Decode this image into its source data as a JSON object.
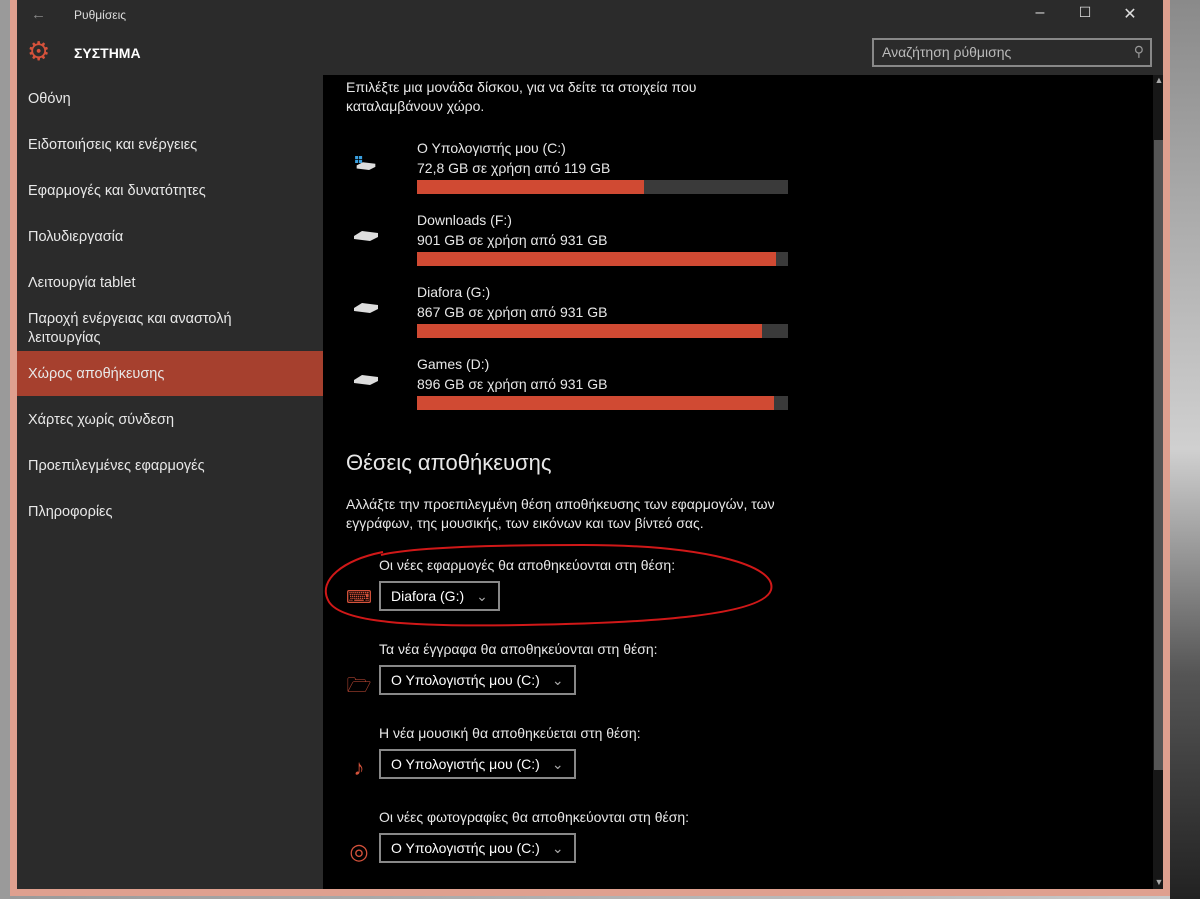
{
  "window": {
    "title": "Ρυθμίσεις",
    "section": "ΣΥΣΤΗΜΑ",
    "search_placeholder": "Αναζήτηση ρύθμισης"
  },
  "sidebar": {
    "items": [
      {
        "label": "Οθόνη"
      },
      {
        "label": "Ειδοποιήσεις και ενέργειες"
      },
      {
        "label": "Εφαρμογές και δυνατότητες"
      },
      {
        "label": "Πολυδιεργασία"
      },
      {
        "label": "Λειτουργία tablet"
      },
      {
        "label": "Παροχή ενέργειας και αναστολή λειτουργίας"
      },
      {
        "label": "Χώρος αποθήκευσης",
        "selected": true
      },
      {
        "label": "Χάρτες χωρίς σύνδεση"
      },
      {
        "label": "Προεπιλεγμένες εφαρμογές"
      },
      {
        "label": "Πληροφορίες"
      }
    ]
  },
  "main": {
    "intro": "Επιλέξτε μια μονάδα δίσκου, για να δείτε τα στοιχεία που καταλαμβάνουν χώρο.",
    "drives": [
      {
        "name": "Ο Υπολογιστής μου (C:)",
        "usage": "72,8 GB σε χρήση από 119 GB",
        "percent": 61.2
      },
      {
        "name": "Downloads (F:)",
        "usage": "901 GB σε χρήση από 931 GB",
        "percent": 96.8
      },
      {
        "name": "Diafora (G:)",
        "usage": "867 GB σε χρήση από 931 GB",
        "percent": 93.1
      },
      {
        "name": "Games (D:)",
        "usage": "896 GB σε χρήση από 931 GB",
        "percent": 96.2
      }
    ],
    "locations_title": "Θέσεις αποθήκευσης",
    "locations_desc": "Αλλάξτε την προεπιλεγμένη θέση αποθήκευσης των εφαρμογών, των εγγράφων, της μουσικής, των εικόνων και των βίντεό σας.",
    "locations": [
      {
        "label": "Οι νέες εφαρμογές θα αποθηκεύονται στη θέση:",
        "value": "Diafora (G:)",
        "icon": "monitor-icon"
      },
      {
        "label": "Τα νέα έγγραφα θα αποθηκεύονται στη θέση:",
        "value": "Ο Υπολογιστής μου (C:)",
        "icon": "documents-folder-icon"
      },
      {
        "label": "Η νέα μουσική θα αποθηκεύεται στη θέση:",
        "value": "Ο Υπολογιστής μου (C:)",
        "icon": "music-note-icon"
      },
      {
        "label": "Οι νέες φωτογραφίες θα αποθηκεύονται στη θέση:",
        "value": "Ο Υπολογιστής μου (C:)",
        "icon": "camera-icon"
      }
    ]
  },
  "colors": {
    "accent": "#d04a33",
    "selected": "#a6402e",
    "border": "#dfa08f"
  }
}
